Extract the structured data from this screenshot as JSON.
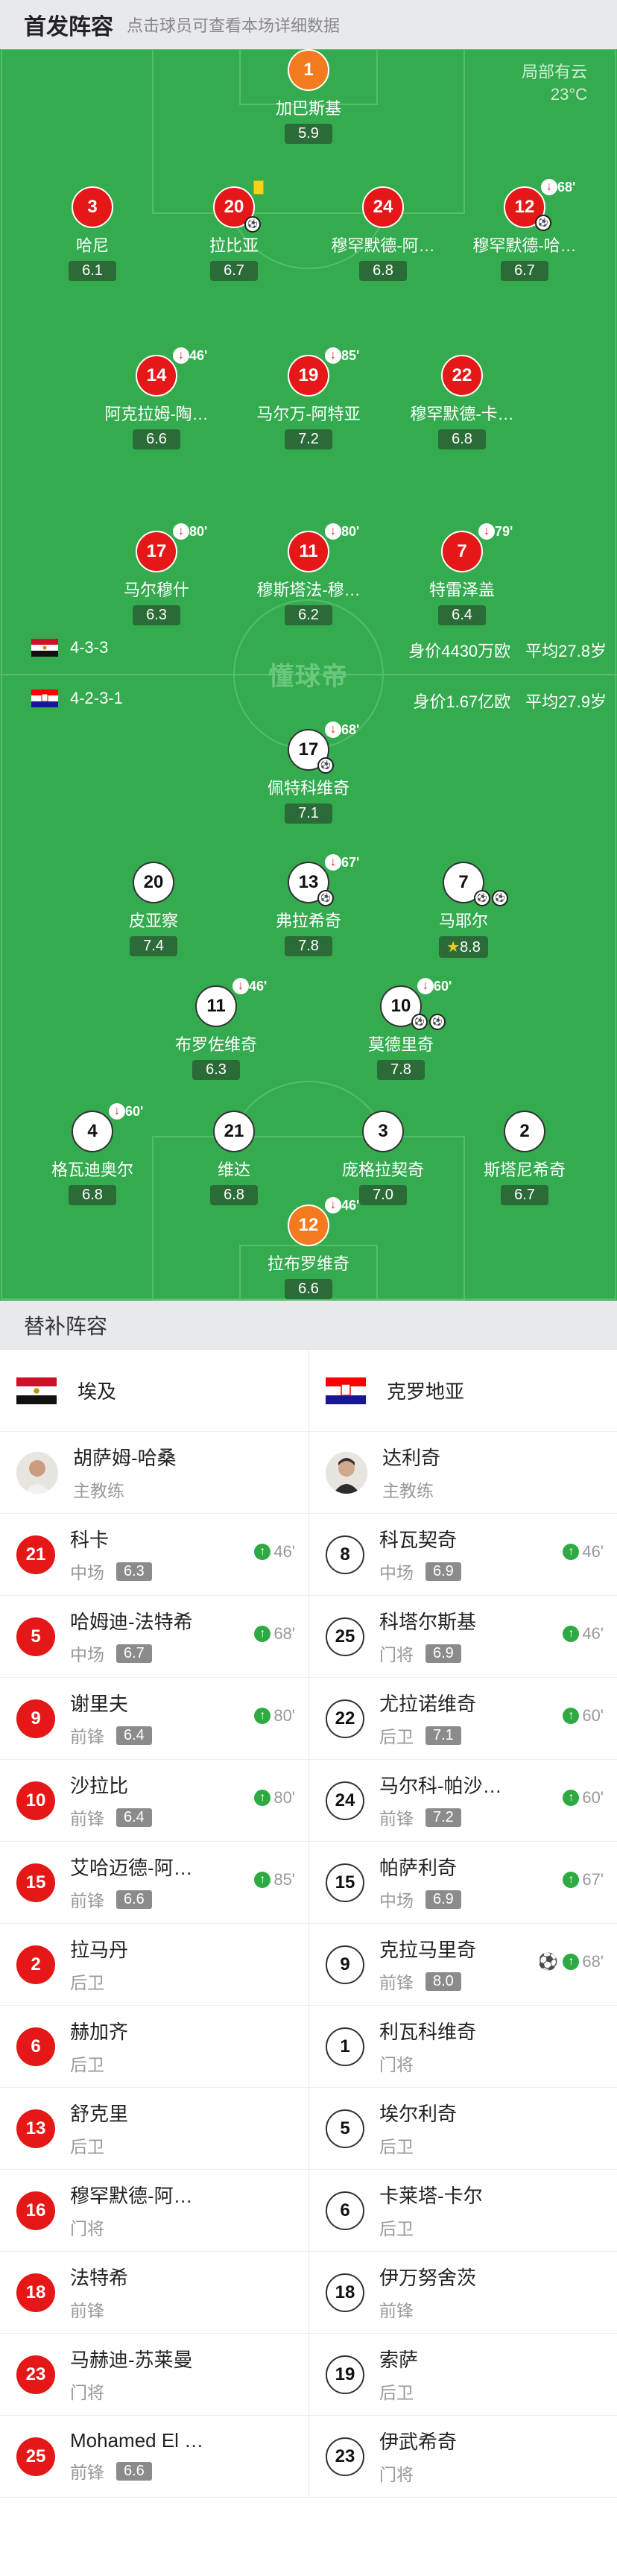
{
  "header": {
    "title": "首发阵容",
    "subtitle": "点击球员可查看本场详细数据"
  },
  "weather": {
    "line1": "局部有云",
    "line2": "23°C"
  },
  "watermark": "懂球帝",
  "home_bar": {
    "formation": "4-3-3",
    "value": "身价4430万欧",
    "avg": "平均27.8岁"
  },
  "away_bar": {
    "formation": "4-2-3-1",
    "value": "身价1.67亿欧",
    "avg": "平均27.9岁"
  },
  "home": [
    {
      "num": "1",
      "name": "加巴斯基",
      "rating": "5.9"
    },
    {
      "num": "3",
      "name": "哈尼",
      "rating": "6.1"
    },
    {
      "num": "20",
      "name": "拉比亚",
      "rating": "6.7"
    },
    {
      "num": "24",
      "name": "穆罕默德-阿…",
      "rating": "6.8"
    },
    {
      "num": "12",
      "name": "穆罕默德-哈…",
      "rating": "6.7",
      "sub": "68'"
    },
    {
      "num": "14",
      "name": "阿克拉姆-陶…",
      "rating": "6.6",
      "sub": "46'"
    },
    {
      "num": "19",
      "name": "马尔万-阿特亚",
      "rating": "7.2",
      "sub": "85'"
    },
    {
      "num": "22",
      "name": "穆罕默德-卡…",
      "rating": "6.8"
    },
    {
      "num": "17",
      "name": "马尔穆什",
      "rating": "6.3",
      "sub": "80'"
    },
    {
      "num": "11",
      "name": "穆斯塔法-穆…",
      "rating": "6.2",
      "sub": "80'"
    },
    {
      "num": "7",
      "name": "特雷泽盖",
      "rating": "6.4",
      "sub": "79'"
    }
  ],
  "away": [
    {
      "num": "17",
      "name": "佩特科维奇",
      "rating": "7.1",
      "sub": "68'"
    },
    {
      "num": "20",
      "name": "皮亚察",
      "rating": "7.4"
    },
    {
      "num": "13",
      "name": "弗拉希奇",
      "rating": "7.8",
      "sub": "67'"
    },
    {
      "num": "7",
      "name": "马耶尔",
      "rating": "8.8"
    },
    {
      "num": "11",
      "name": "布罗佐维奇",
      "rating": "6.3",
      "sub": "46'"
    },
    {
      "num": "10",
      "name": "莫德里奇",
      "rating": "7.8",
      "sub": "60'"
    },
    {
      "num": "4",
      "name": "格瓦迪奥尔",
      "rating": "6.8",
      "sub": "60'"
    },
    {
      "num": "21",
      "name": "维达",
      "rating": "6.8"
    },
    {
      "num": "3",
      "name": "庞格拉契奇",
      "rating": "7.0"
    },
    {
      "num": "2",
      "name": "斯塔尼希奇",
      "rating": "6.7"
    },
    {
      "num": "12",
      "name": "拉布罗维奇",
      "rating": "6.6",
      "sub": "46'"
    }
  ],
  "bench": {
    "title": "替补阵容",
    "home_team": "埃及",
    "away_team": "克罗地亚",
    "home_coach": {
      "name": "胡萨姆-哈桑",
      "role": "主教练"
    },
    "away_coach": {
      "name": "达利奇",
      "role": "主教练"
    },
    "home_subs": [
      {
        "num": "21",
        "name": "科卡",
        "pos": "中场",
        "rating": "6.3",
        "in": "46'"
      },
      {
        "num": "5",
        "name": "哈姆迪-法特希",
        "pos": "中场",
        "rating": "6.7",
        "in": "68'"
      },
      {
        "num": "9",
        "name": "谢里夫",
        "pos": "前锋",
        "rating": "6.4",
        "in": "80'"
      },
      {
        "num": "10",
        "name": "沙拉比",
        "pos": "前锋",
        "rating": "6.4",
        "in": "80'"
      },
      {
        "num": "15",
        "name": "艾哈迈德-阿…",
        "pos": "前锋",
        "rating": "6.6",
        "in": "85'"
      },
      {
        "num": "2",
        "name": "拉马丹",
        "pos": "后卫"
      },
      {
        "num": "6",
        "name": "赫加齐",
        "pos": "后卫"
      },
      {
        "num": "13",
        "name": "舒克里",
        "pos": "后卫"
      },
      {
        "num": "16",
        "name": "穆罕默德-阿…",
        "pos": "门将"
      },
      {
        "num": "18",
        "name": "法特希",
        "pos": "前锋"
      },
      {
        "num": "23",
        "name": "马赫迪-苏莱曼",
        "pos": "门将"
      },
      {
        "num": "25",
        "name": "Mohamed El …",
        "pos": "前锋",
        "rating": "6.6"
      }
    ],
    "away_subs": [
      {
        "num": "8",
        "name": "科瓦契奇",
        "pos": "中场",
        "rating": "6.9",
        "in": "46'"
      },
      {
        "num": "25",
        "name": "科塔尔斯基",
        "pos": "门将",
        "rating": "6.9",
        "in": "46'"
      },
      {
        "num": "22",
        "name": "尤拉诺维奇",
        "pos": "后卫",
        "rating": "7.1",
        "in": "60'"
      },
      {
        "num": "24",
        "name": "马尔科-帕沙…",
        "pos": "前锋",
        "rating": "7.2",
        "in": "60'"
      },
      {
        "num": "15",
        "name": "帕萨利奇",
        "pos": "中场",
        "rating": "6.9",
        "in": "67'"
      },
      {
        "num": "9",
        "name": "克拉马里奇",
        "pos": "前锋",
        "rating": "8.0",
        "in": "68'"
      },
      {
        "num": "1",
        "name": "利瓦科维奇",
        "pos": "门将"
      },
      {
        "num": "5",
        "name": "埃尔利奇",
        "pos": "后卫"
      },
      {
        "num": "6",
        "name": "卡莱塔-卡尔",
        "pos": "后卫"
      },
      {
        "num": "18",
        "name": "伊万努舍茨",
        "pos": "前锋"
      },
      {
        "num": "19",
        "name": "索萨",
        "pos": "后卫"
      },
      {
        "num": "23",
        "name": "伊武希奇",
        "pos": "门将"
      }
    ]
  }
}
